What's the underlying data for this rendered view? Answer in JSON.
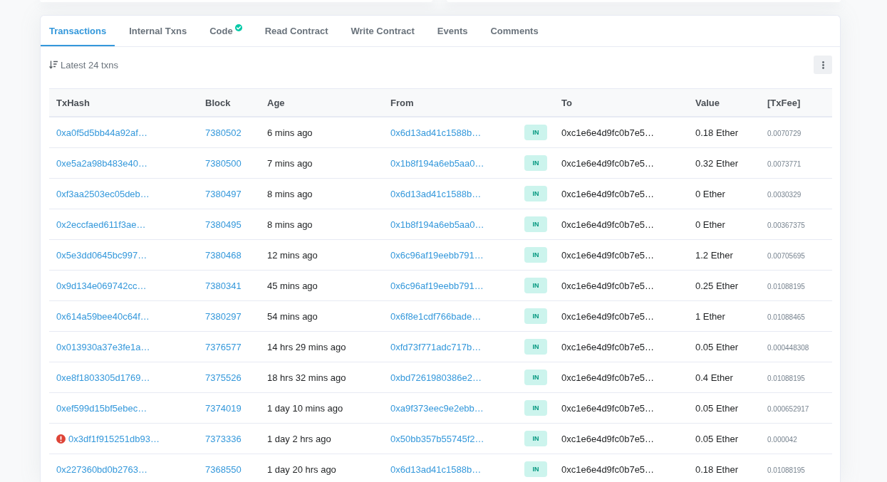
{
  "tabs": [
    {
      "label": "Transactions",
      "selected": true,
      "verified": false
    },
    {
      "label": "Internal Txns",
      "selected": false,
      "verified": false
    },
    {
      "label": "Code",
      "selected": false,
      "verified": true
    },
    {
      "label": "Read Contract",
      "selected": false,
      "verified": false
    },
    {
      "label": "Write Contract",
      "selected": false,
      "verified": false
    },
    {
      "label": "Events",
      "selected": false,
      "verified": false
    },
    {
      "label": "Comments",
      "selected": false,
      "verified": false
    }
  ],
  "toolbar": {
    "summary": "Latest 24 txns"
  },
  "table": {
    "columns": [
      "TxHash",
      "Block",
      "Age",
      "From",
      "To",
      "Value",
      "[TxFee]"
    ],
    "rows": [
      {
        "tx_hash": "0xa0f5d5bb44a92af…",
        "failed": false,
        "block": "7380502",
        "age": "6 mins ago",
        "from": "0x6d13ad41c1588b…",
        "direction": "IN",
        "to": "0xc1e6e4d9fc0b7e5…",
        "value": "0.18 Ether",
        "fee": "0.0070729"
      },
      {
        "tx_hash": "0xe5a2a98b483e40…",
        "failed": false,
        "block": "7380500",
        "age": "7 mins ago",
        "from": "0x1b8f194a6eb5aa0…",
        "direction": "IN",
        "to": "0xc1e6e4d9fc0b7e5…",
        "value": "0.32 Ether",
        "fee": "0.0073771"
      },
      {
        "tx_hash": "0xf3aa2503ec05deb…",
        "failed": false,
        "block": "7380497",
        "age": "8 mins ago",
        "from": "0x6d13ad41c1588b…",
        "direction": "IN",
        "to": "0xc1e6e4d9fc0b7e5…",
        "value": "0 Ether",
        "fee": "0.0030329"
      },
      {
        "tx_hash": "0x2eccfaed611f3ae…",
        "failed": false,
        "block": "7380495",
        "age": "8 mins ago",
        "from": "0x1b8f194a6eb5aa0…",
        "direction": "IN",
        "to": "0xc1e6e4d9fc0b7e5…",
        "value": "0 Ether",
        "fee": "0.00367375"
      },
      {
        "tx_hash": "0x5e3dd0645bc997…",
        "failed": false,
        "block": "7380468",
        "age": "12 mins ago",
        "from": "0x6c96af19eebb791…",
        "direction": "IN",
        "to": "0xc1e6e4d9fc0b7e5…",
        "value": "1.2 Ether",
        "fee": "0.00705695"
      },
      {
        "tx_hash": "0x9d134e069742cc…",
        "failed": false,
        "block": "7380341",
        "age": "45 mins ago",
        "from": "0x6c96af19eebb791…",
        "direction": "IN",
        "to": "0xc1e6e4d9fc0b7e5…",
        "value": "0.25 Ether",
        "fee": "0.01088195"
      },
      {
        "tx_hash": "0x614a59bee40c64f…",
        "failed": false,
        "block": "7380297",
        "age": "54 mins ago",
        "from": "0x6f8e1cdf766bade…",
        "direction": "IN",
        "to": "0xc1e6e4d9fc0b7e5…",
        "value": "1 Ether",
        "fee": "0.01088465"
      },
      {
        "tx_hash": "0x013930a37e3fe1a…",
        "failed": false,
        "block": "7376577",
        "age": "14 hrs 29 mins ago",
        "from": "0xfd73f771adc717b…",
        "direction": "IN",
        "to": "0xc1e6e4d9fc0b7e5…",
        "value": "0.05 Ether",
        "fee": "0.000448308"
      },
      {
        "tx_hash": "0xe8f1803305d1769…",
        "failed": false,
        "block": "7375526",
        "age": "18 hrs 32 mins ago",
        "from": "0xbd7261980386e2…",
        "direction": "IN",
        "to": "0xc1e6e4d9fc0b7e5…",
        "value": "0.4 Ether",
        "fee": "0.01088195"
      },
      {
        "tx_hash": "0xef599d15bf5ebec…",
        "failed": false,
        "block": "7374019",
        "age": "1 day 10 mins ago",
        "from": "0xa9f373eec9e2ebb…",
        "direction": "IN",
        "to": "0xc1e6e4d9fc0b7e5…",
        "value": "0.05 Ether",
        "fee": "0.000652917"
      },
      {
        "tx_hash": "0x3df1f915251db93…",
        "failed": true,
        "block": "7373336",
        "age": "1 day 2 hrs ago",
        "from": "0x50bb357b55745f2…",
        "direction": "IN",
        "to": "0xc1e6e4d9fc0b7e5…",
        "value": "0.05 Ether",
        "fee": "0.000042"
      },
      {
        "tx_hash": "0x227360bd0b2763…",
        "failed": false,
        "block": "7368550",
        "age": "1 day 20 hrs ago",
        "from": "0x6d13ad41c1588b…",
        "direction": "IN",
        "to": "0xc1e6e4d9fc0b7e5…",
        "value": "0.18 Ether",
        "fee": "0.01088195"
      }
    ]
  }
}
